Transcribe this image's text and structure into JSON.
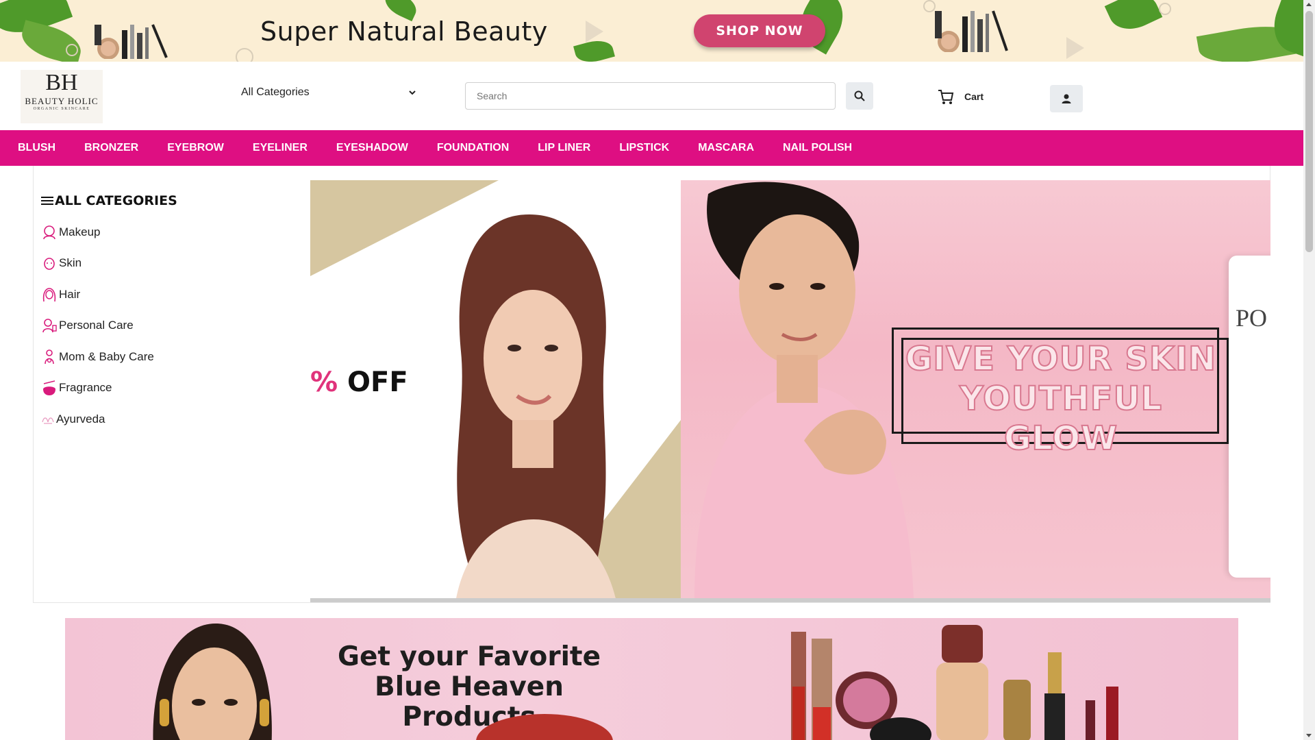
{
  "promo": {
    "title": "Super Natural Beauty",
    "button_label": "SHOP NOW"
  },
  "header": {
    "logo": {
      "monogram": "BH",
      "name": "BEAUTY HOLIC",
      "tagline": "ORGANIC SKINCARE"
    },
    "category_select": "All Categories",
    "search_placeholder": "Search",
    "cart_label": "Cart"
  },
  "nav": {
    "items": [
      "BLUSH",
      "BRONZER",
      "EYEBROW",
      "EYELINER",
      "EYESHADOW",
      "FOUNDATION",
      "LIP LINER",
      "LIPSTICK",
      "MASCARA",
      "NAIL POLISH"
    ]
  },
  "sidebar": {
    "title": "ALL CATEGORIES",
    "items": [
      {
        "label": "Makeup",
        "icon": "makeup-icon"
      },
      {
        "label": "Skin",
        "icon": "skin-icon"
      },
      {
        "label": "Hair",
        "icon": "hair-icon"
      },
      {
        "label": "Personal Care",
        "icon": "personal-care-icon"
      },
      {
        "label": "Mom & Baby Care",
        "icon": "mom-baby-icon"
      },
      {
        "label": "Fragrance",
        "icon": "fragrance-icon"
      },
      {
        "label": "Ayurveda",
        "icon": "ayurveda-icon"
      }
    ]
  },
  "hero": {
    "slide1_text_pct": "%",
    "slide1_text_off": "OFF",
    "slide2_text": "GIVE YOUR SKIN YOUTHFUL GLOW",
    "slide2_brand": "PO"
  },
  "banner2": {
    "title": "Get your Favorite Blue Heaven Products"
  },
  "colors": {
    "accent": "#de0f82",
    "promo_bg": "#fbeed4",
    "shop_button": "#d0446f"
  }
}
